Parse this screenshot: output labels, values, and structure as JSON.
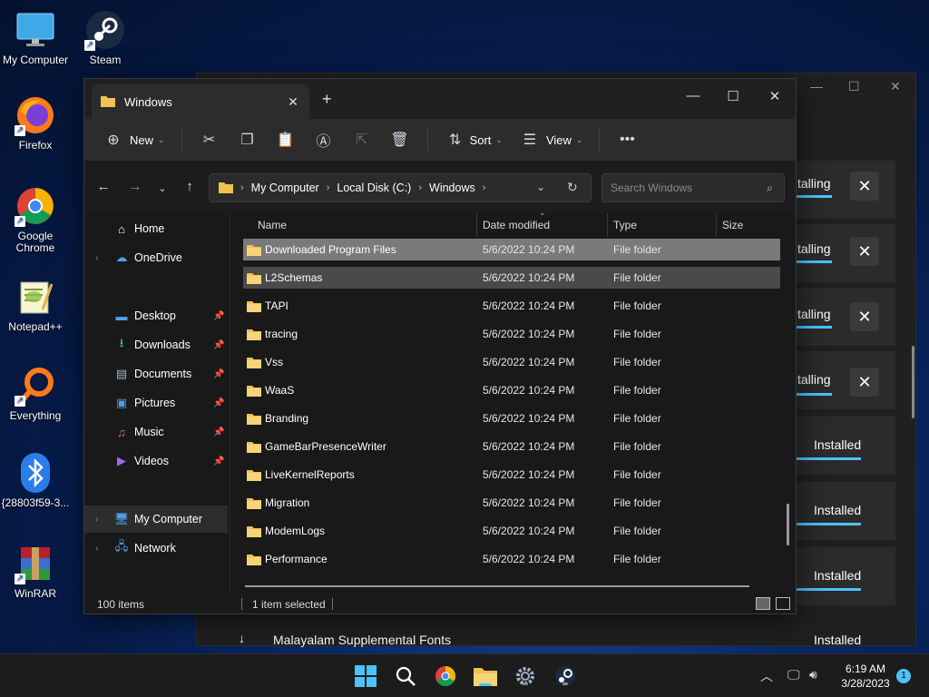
{
  "desktop": {
    "icons": [
      {
        "label": "My Computer"
      },
      {
        "label": "Steam"
      },
      {
        "label": "Firefox"
      },
      {
        "label": "Google Chrome"
      },
      {
        "label": "Notepad++"
      },
      {
        "label": "Everything"
      },
      {
        "label": "{28803f59-3..."
      },
      {
        "label": "WinRAR"
      }
    ]
  },
  "installer": {
    "items": [
      {
        "status": "talling"
      },
      {
        "status": "talling"
      },
      {
        "status": "talling"
      },
      {
        "status": "talling"
      },
      {
        "status": "Installed"
      },
      {
        "status": "Installed"
      },
      {
        "status": "Installed"
      }
    ],
    "bottom_item": {
      "name": "Malayalam Supplemental Fonts",
      "status": "Installed"
    }
  },
  "explorer": {
    "tab_title": "Windows",
    "toolbar": {
      "new_label": "New",
      "sort_label": "Sort",
      "view_label": "View"
    },
    "breadcrumb": [
      "My Computer",
      "Local Disk (C:)",
      "Windows"
    ],
    "search_placeholder": "Search Windows",
    "sidebar": [
      {
        "label": "Home"
      },
      {
        "label": "OneDrive"
      },
      {
        "label": "Desktop"
      },
      {
        "label": "Downloads"
      },
      {
        "label": "Documents"
      },
      {
        "label": "Pictures"
      },
      {
        "label": "Music"
      },
      {
        "label": "Videos"
      },
      {
        "label": "My Computer"
      },
      {
        "label": "Network"
      }
    ],
    "columns": {
      "name": "Name",
      "date": "Date modified",
      "type": "Type",
      "size": "Size"
    },
    "rows": [
      {
        "name": "Downloaded Program Files",
        "date": "5/6/2022 10:24 PM",
        "type": "File folder"
      },
      {
        "name": "L2Schemas",
        "date": "5/6/2022 10:24 PM",
        "type": "File folder"
      },
      {
        "name": "TAPI",
        "date": "5/6/2022 10:24 PM",
        "type": "File folder"
      },
      {
        "name": "tracing",
        "date": "5/6/2022 10:24 PM",
        "type": "File folder"
      },
      {
        "name": "Vss",
        "date": "5/6/2022 10:24 PM",
        "type": "File folder"
      },
      {
        "name": "WaaS",
        "date": "5/6/2022 10:24 PM",
        "type": "File folder"
      },
      {
        "name": "Branding",
        "date": "5/6/2022 10:24 PM",
        "type": "File folder"
      },
      {
        "name": "GameBarPresenceWriter",
        "date": "5/6/2022 10:24 PM",
        "type": "File folder"
      },
      {
        "name": "LiveKernelReports",
        "date": "5/6/2022 10:24 PM",
        "type": "File folder"
      },
      {
        "name": "Migration",
        "date": "5/6/2022 10:24 PM",
        "type": "File folder"
      },
      {
        "name": "ModemLogs",
        "date": "5/6/2022 10:24 PM",
        "type": "File folder"
      },
      {
        "name": "Performance",
        "date": "5/6/2022 10:24 PM",
        "type": "File folder"
      }
    ],
    "status": {
      "count": "100 items",
      "selected": "1 item selected"
    }
  },
  "taskbar": {
    "time": "6:19 AM",
    "date": "3/28/2023",
    "notification_count": "1"
  },
  "colors": {
    "accent": "#4cc2ff",
    "folder": "#f2c24e",
    "selected_row": "#7a7a7a"
  }
}
